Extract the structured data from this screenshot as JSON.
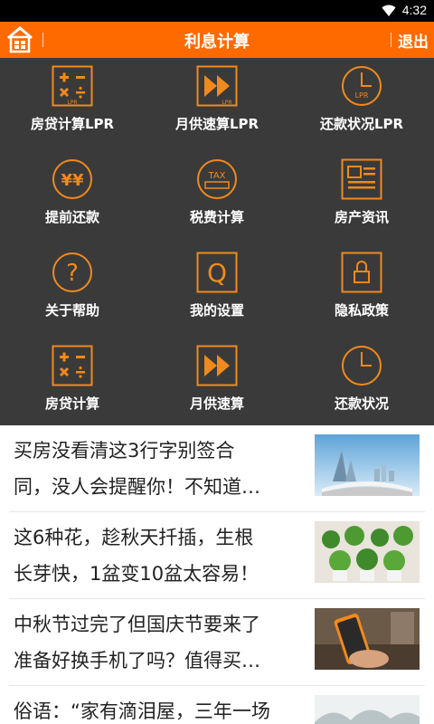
{
  "status_bar": {
    "time": "4:32"
  },
  "header": {
    "title": "利息计算",
    "exit_label": "退出"
  },
  "menu": [
    {
      "label": "房贷计算LPR",
      "icon": "calculator-icon"
    },
    {
      "label": "月供速算LPR",
      "icon": "fast-forward-icon"
    },
    {
      "label": "还款状况LPR",
      "icon": "clock-icon"
    },
    {
      "label": "提前还款",
      "icon": "yen-coin-icon",
      "icon_text": "¥¥"
    },
    {
      "label": "税费计算",
      "icon": "tax-icon",
      "icon_text": "TAX"
    },
    {
      "label": "房产资讯",
      "icon": "news-icon"
    },
    {
      "label": "关于帮助",
      "icon": "help-icon",
      "icon_text": "?"
    },
    {
      "label": "我的设置",
      "icon": "settings-q-icon",
      "icon_text": "Q"
    },
    {
      "label": "隐私政策",
      "icon": "lock-icon"
    },
    {
      "label": "房贷计算",
      "icon": "calculator-icon"
    },
    {
      "label": "月供速算",
      "icon": "fast-forward-icon"
    },
    {
      "label": "还款状况",
      "icon": "clock-icon"
    }
  ],
  "icon_badge": "LPR",
  "news": [
    {
      "line1": "买房没看清这3行字别签合",
      "line2": "同，没人会提醒你！不知道…",
      "thumb": "city-book-image"
    },
    {
      "line1": "这6种花，趁秋天扦插，生根",
      "line2": "长芽快，1盆变10盆太容易！",
      "thumb": "potted-plants-image"
    },
    {
      "line1": "中秋节过完了但国庆节要来了",
      "line2": "准备好换手机了吗？值得买…",
      "thumb": "phone-hand-image"
    },
    {
      "line1": "俗语：“家有滴泪屋，三年一场",
      "line2": "",
      "thumb": "landscape-painting-image"
    }
  ],
  "colors": {
    "accent": "#ff6a00",
    "icon": "#f08a1c",
    "grid_bg": "#3a3a3a"
  }
}
